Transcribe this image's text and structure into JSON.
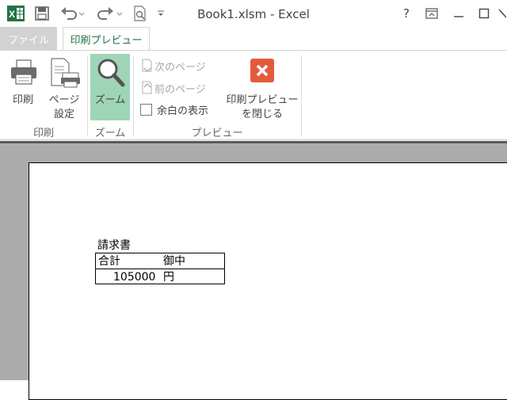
{
  "window": {
    "title": "Book1.xlsm - Excel"
  },
  "qat": {
    "app_icon": "excel-logo",
    "icons": [
      "save-icon",
      "undo-icon",
      "redo-icon",
      "print-preview-icon",
      "customize-icon"
    ]
  },
  "window_controls": {
    "help": "?",
    "ribbon_options": "ribbon-display-icon",
    "minimize": "—",
    "maximize": "☐",
    "close": "✕"
  },
  "tabs": [
    {
      "label": "ファイル"
    },
    {
      "label": "印刷プレビュー"
    }
  ],
  "ribbon": {
    "print_group": {
      "label": "印刷",
      "print_button": "印刷",
      "page_setup_line1": "ページ",
      "page_setup_line2": "設定"
    },
    "zoom_group": {
      "label": "ズーム",
      "zoom_button": "ズーム"
    },
    "preview_group": {
      "label": "プレビュー",
      "next_page": "次のページ",
      "prev_page": "前のページ",
      "show_margins": "余白の表示",
      "show_margins_checked": false,
      "close_line1": "印刷プレビュー",
      "close_line2": "を閉じる"
    }
  },
  "document": {
    "heading": "請求書",
    "row1_label": "合計",
    "row1_suffix": "御中",
    "row2_amount": "105000",
    "row2_unit": "円"
  },
  "colors": {
    "excel_green": "#217346",
    "zoom_active": "#9fd5b7",
    "close_red": "#e25b3b"
  }
}
